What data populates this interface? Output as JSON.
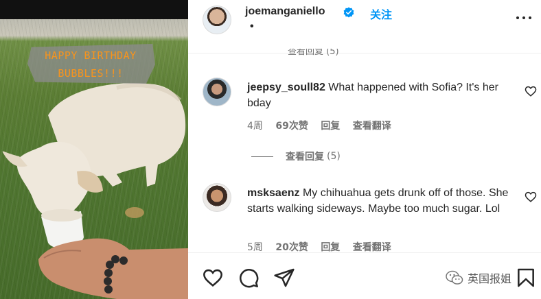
{
  "media": {
    "banner_text": "HAPPY BIRTHDAY\nBUBBLES!!!"
  },
  "post_header": {
    "username": "joemanganiello",
    "verified_icon": "verified-badge-icon",
    "follow_label": "关注",
    "separator": "•",
    "more_icon": "more-options-icon"
  },
  "partial_reply_text": "查看回复 (5)",
  "comments": [
    {
      "username": "jeepsy_soull82",
      "text": "What happened with Sofia? It's her bday",
      "time": "4周",
      "likes": "69次赞",
      "reply_label": "回复",
      "translate_label": "查看翻译"
    },
    {
      "username": "msksaenz",
      "text": "My chihuahua gets drunk off of those. She starts walking sideways. Maybe too much sugar. Lol",
      "time": "5周",
      "likes": "20次赞",
      "reply_label": "回复",
      "translate_label": "查看翻译"
    }
  ],
  "view_replies": {
    "label": "查看回复",
    "count": "(5)"
  },
  "action_bar": {
    "icons": [
      "heart-icon",
      "comment-icon",
      "share-icon",
      "bookmark-icon"
    ]
  },
  "watermark": {
    "text": "英国报姐"
  },
  "colors": {
    "follow": "#0095f6",
    "banner_text": "#f7941d",
    "meta_text": "#737373"
  }
}
